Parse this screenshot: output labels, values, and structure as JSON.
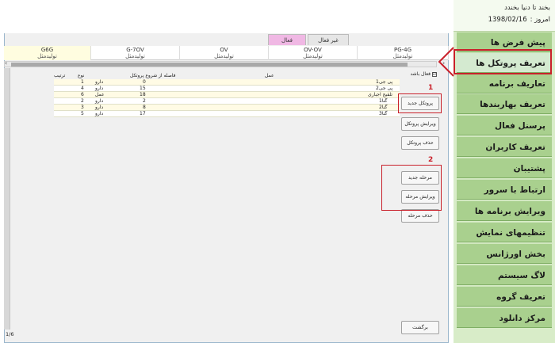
{
  "sidebar": {
    "welcome": "بخند تا دنیا بخندد",
    "date_label": "امروز :",
    "date_value": "1398/02/16",
    "items": [
      {
        "label": "پیش فرض ها"
      },
      {
        "label": "تعریف پروتکل ها"
      },
      {
        "label": "تعاریف برنامه"
      },
      {
        "label": "تعریف بهاربندها"
      },
      {
        "label": "پرسنل فعال"
      },
      {
        "label": "تعریف کاربران"
      },
      {
        "label": "پشتیبان"
      },
      {
        "label": "ارتباط با سرور"
      },
      {
        "label": "ویرایش برنامه ها"
      },
      {
        "label": "تنظیمهای نمایش"
      },
      {
        "label": "بخش اورژانس"
      },
      {
        "label": "لاگ سیستم"
      },
      {
        "label": "تعریف گروه"
      },
      {
        "label": "مرکز دانلود"
      }
    ],
    "active_index": 1
  },
  "tabs": {
    "active": "فعال",
    "inactive": "غیر فعال"
  },
  "protocols": [
    {
      "name": "G6G",
      "status": "تولیدمثل"
    },
    {
      "name": "G-7OV",
      "status": "تولیدمثل"
    },
    {
      "name": "OV",
      "status": "تولیدمثل"
    },
    {
      "name": "OV-OV",
      "status": "تولیدمثل"
    },
    {
      "name": "PG-4G",
      "status": "تولیدمثل"
    }
  ],
  "active_checkbox": {
    "label": "فعال باشد",
    "checked": "☑"
  },
  "table": {
    "headers": {
      "order": "ترتیب",
      "type": "نوع",
      "distance": "فاصله از شروع پروتکل",
      "action": "عمل"
    },
    "rows": [
      {
        "order": "1",
        "type": "دارو",
        "distance": "0",
        "action": "پی جی1"
      },
      {
        "order": "4",
        "type": "دارو",
        "distance": "15",
        "action": "پی جی2"
      },
      {
        "order": "6",
        "type": "عمل",
        "distance": "18",
        "action": "تلقیح اجباری"
      },
      {
        "order": "2",
        "type": "دارو",
        "distance": "2",
        "action": "گنا1"
      },
      {
        "order": "3",
        "type": "دارو",
        "distance": "8",
        "action": "گنا2"
      },
      {
        "order": "5",
        "type": "دارو",
        "distance": "17",
        "action": "گنا3"
      }
    ]
  },
  "buttons": {
    "new_protocol": "پروتکل جدید",
    "edit_protocol": "ویرایش پروتکل",
    "delete_protocol": "حذف پروتکل",
    "new_step": "مرحله جدید",
    "edit_step": "ویرایش مرحله",
    "delete_step": "حذف مرحله",
    "back": "برگشت"
  },
  "annotations": {
    "one": "1",
    "two": "2"
  },
  "status": {
    "page": "1/6"
  },
  "colors": {
    "sidebar_bg": "#a9d08e",
    "accent_red": "#c9202a",
    "active_tab": "#f0b8e4",
    "row_highlight": "#fffbe5"
  }
}
